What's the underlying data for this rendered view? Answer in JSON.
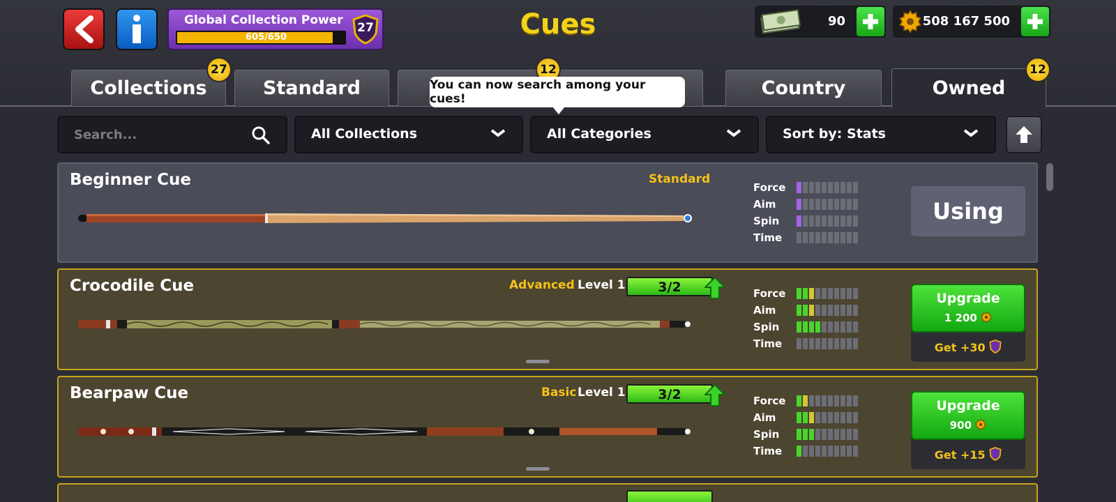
{
  "header": {
    "title": "Cues",
    "global_collection_power": {
      "label": "Global Collection Power",
      "progress_text": "605/650",
      "level": "27",
      "progress": 0.93
    },
    "cash": "90",
    "coins": "508 167 500"
  },
  "tabs": [
    {
      "label": "Collections",
      "badge": "27"
    },
    {
      "label": "Standard"
    },
    {
      "label": "",
      "badge": "12"
    },
    {
      "label": "Country"
    },
    {
      "label": "Owned",
      "badge": "12"
    }
  ],
  "tooltip": "You can now search among your cues!",
  "filters": {
    "search_placeholder": "Search...",
    "collections": "All Collections",
    "categories": "All Categories",
    "sort": "Sort by: Stats"
  },
  "stat_labels": [
    "Force",
    "Aim",
    "Spin",
    "Time"
  ],
  "cues": [
    {
      "name": "Beginner Cue",
      "category": "Standard",
      "level_label": "",
      "progress_text": "",
      "stats": {
        "force": 1,
        "aim": 1,
        "spin": 1,
        "time": 0
      },
      "action": "Using"
    },
    {
      "name": "Crocodile Cue",
      "category": "Advanced",
      "level_label": "Level 1",
      "progress_text": "3/2",
      "stats": {
        "force": 3,
        "aim": 3,
        "spin": 4,
        "time": 0
      },
      "action": "Upgrade",
      "cost": "1 200",
      "get": "Get +30"
    },
    {
      "name": "Bearpaw Cue",
      "category": "Basic",
      "level_label": "Level 1",
      "progress_text": "3/2",
      "stats": {
        "force": 2,
        "aim": 3,
        "spin": 3,
        "time": 1
      },
      "action": "Upgrade",
      "cost": "900",
      "get": "Get +15"
    }
  ],
  "colors": {
    "accent_yellow": "#f3c21a",
    "green": "#2dbb17",
    "purple": "#7b3cc0"
  }
}
